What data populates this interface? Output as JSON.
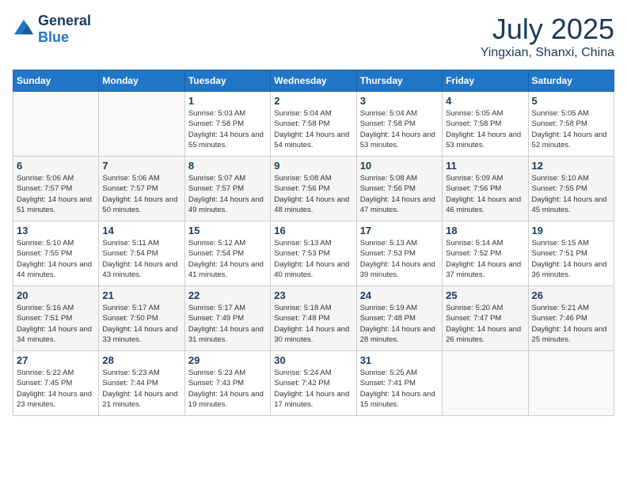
{
  "header": {
    "logo_general": "General",
    "logo_blue": "Blue",
    "month": "July 2025",
    "location": "Yingxian, Shanxi, China"
  },
  "weekdays": [
    "Sunday",
    "Monday",
    "Tuesday",
    "Wednesday",
    "Thursday",
    "Friday",
    "Saturday"
  ],
  "weeks": [
    [
      {
        "day": "",
        "sunrise": "",
        "sunset": "",
        "daylight": ""
      },
      {
        "day": "",
        "sunrise": "",
        "sunset": "",
        "daylight": ""
      },
      {
        "day": "1",
        "sunrise": "Sunrise: 5:03 AM",
        "sunset": "Sunset: 7:58 PM",
        "daylight": "Daylight: 14 hours and 55 minutes."
      },
      {
        "day": "2",
        "sunrise": "Sunrise: 5:04 AM",
        "sunset": "Sunset: 7:58 PM",
        "daylight": "Daylight: 14 hours and 54 minutes."
      },
      {
        "day": "3",
        "sunrise": "Sunrise: 5:04 AM",
        "sunset": "Sunset: 7:58 PM",
        "daylight": "Daylight: 14 hours and 53 minutes."
      },
      {
        "day": "4",
        "sunrise": "Sunrise: 5:05 AM",
        "sunset": "Sunset: 7:58 PM",
        "daylight": "Daylight: 14 hours and 53 minutes."
      },
      {
        "day": "5",
        "sunrise": "Sunrise: 5:05 AM",
        "sunset": "Sunset: 7:58 PM",
        "daylight": "Daylight: 14 hours and 52 minutes."
      }
    ],
    [
      {
        "day": "6",
        "sunrise": "Sunrise: 5:06 AM",
        "sunset": "Sunset: 7:57 PM",
        "daylight": "Daylight: 14 hours and 51 minutes."
      },
      {
        "day": "7",
        "sunrise": "Sunrise: 5:06 AM",
        "sunset": "Sunset: 7:57 PM",
        "daylight": "Daylight: 14 hours and 50 minutes."
      },
      {
        "day": "8",
        "sunrise": "Sunrise: 5:07 AM",
        "sunset": "Sunset: 7:57 PM",
        "daylight": "Daylight: 14 hours and 49 minutes."
      },
      {
        "day": "9",
        "sunrise": "Sunrise: 5:08 AM",
        "sunset": "Sunset: 7:56 PM",
        "daylight": "Daylight: 14 hours and 48 minutes."
      },
      {
        "day": "10",
        "sunrise": "Sunrise: 5:08 AM",
        "sunset": "Sunset: 7:56 PM",
        "daylight": "Daylight: 14 hours and 47 minutes."
      },
      {
        "day": "11",
        "sunrise": "Sunrise: 5:09 AM",
        "sunset": "Sunset: 7:56 PM",
        "daylight": "Daylight: 14 hours and 46 minutes."
      },
      {
        "day": "12",
        "sunrise": "Sunrise: 5:10 AM",
        "sunset": "Sunset: 7:55 PM",
        "daylight": "Daylight: 14 hours and 45 minutes."
      }
    ],
    [
      {
        "day": "13",
        "sunrise": "Sunrise: 5:10 AM",
        "sunset": "Sunset: 7:55 PM",
        "daylight": "Daylight: 14 hours and 44 minutes."
      },
      {
        "day": "14",
        "sunrise": "Sunrise: 5:11 AM",
        "sunset": "Sunset: 7:54 PM",
        "daylight": "Daylight: 14 hours and 43 minutes."
      },
      {
        "day": "15",
        "sunrise": "Sunrise: 5:12 AM",
        "sunset": "Sunset: 7:54 PM",
        "daylight": "Daylight: 14 hours and 41 minutes."
      },
      {
        "day": "16",
        "sunrise": "Sunrise: 5:13 AM",
        "sunset": "Sunset: 7:53 PM",
        "daylight": "Daylight: 14 hours and 40 minutes."
      },
      {
        "day": "17",
        "sunrise": "Sunrise: 5:13 AM",
        "sunset": "Sunset: 7:53 PM",
        "daylight": "Daylight: 14 hours and 39 minutes."
      },
      {
        "day": "18",
        "sunrise": "Sunrise: 5:14 AM",
        "sunset": "Sunset: 7:52 PM",
        "daylight": "Daylight: 14 hours and 37 minutes."
      },
      {
        "day": "19",
        "sunrise": "Sunrise: 5:15 AM",
        "sunset": "Sunset: 7:51 PM",
        "daylight": "Daylight: 14 hours and 36 minutes."
      }
    ],
    [
      {
        "day": "20",
        "sunrise": "Sunrise: 5:16 AM",
        "sunset": "Sunset: 7:51 PM",
        "daylight": "Daylight: 14 hours and 34 minutes."
      },
      {
        "day": "21",
        "sunrise": "Sunrise: 5:17 AM",
        "sunset": "Sunset: 7:50 PM",
        "daylight": "Daylight: 14 hours and 33 minutes."
      },
      {
        "day": "22",
        "sunrise": "Sunrise: 5:17 AM",
        "sunset": "Sunset: 7:49 PM",
        "daylight": "Daylight: 14 hours and 31 minutes."
      },
      {
        "day": "23",
        "sunrise": "Sunrise: 5:18 AM",
        "sunset": "Sunset: 7:48 PM",
        "daylight": "Daylight: 14 hours and 30 minutes."
      },
      {
        "day": "24",
        "sunrise": "Sunrise: 5:19 AM",
        "sunset": "Sunset: 7:48 PM",
        "daylight": "Daylight: 14 hours and 28 minutes."
      },
      {
        "day": "25",
        "sunrise": "Sunrise: 5:20 AM",
        "sunset": "Sunset: 7:47 PM",
        "daylight": "Daylight: 14 hours and 26 minutes."
      },
      {
        "day": "26",
        "sunrise": "Sunrise: 5:21 AM",
        "sunset": "Sunset: 7:46 PM",
        "daylight": "Daylight: 14 hours and 25 minutes."
      }
    ],
    [
      {
        "day": "27",
        "sunrise": "Sunrise: 5:22 AM",
        "sunset": "Sunset: 7:45 PM",
        "daylight": "Daylight: 14 hours and 23 minutes."
      },
      {
        "day": "28",
        "sunrise": "Sunrise: 5:23 AM",
        "sunset": "Sunset: 7:44 PM",
        "daylight": "Daylight: 14 hours and 21 minutes."
      },
      {
        "day": "29",
        "sunrise": "Sunrise: 5:23 AM",
        "sunset": "Sunset: 7:43 PM",
        "daylight": "Daylight: 14 hours and 19 minutes."
      },
      {
        "day": "30",
        "sunrise": "Sunrise: 5:24 AM",
        "sunset": "Sunset: 7:42 PM",
        "daylight": "Daylight: 14 hours and 17 minutes."
      },
      {
        "day": "31",
        "sunrise": "Sunrise: 5:25 AM",
        "sunset": "Sunset: 7:41 PM",
        "daylight": "Daylight: 14 hours and 15 minutes."
      },
      {
        "day": "",
        "sunrise": "",
        "sunset": "",
        "daylight": ""
      },
      {
        "day": "",
        "sunrise": "",
        "sunset": "",
        "daylight": ""
      }
    ]
  ]
}
